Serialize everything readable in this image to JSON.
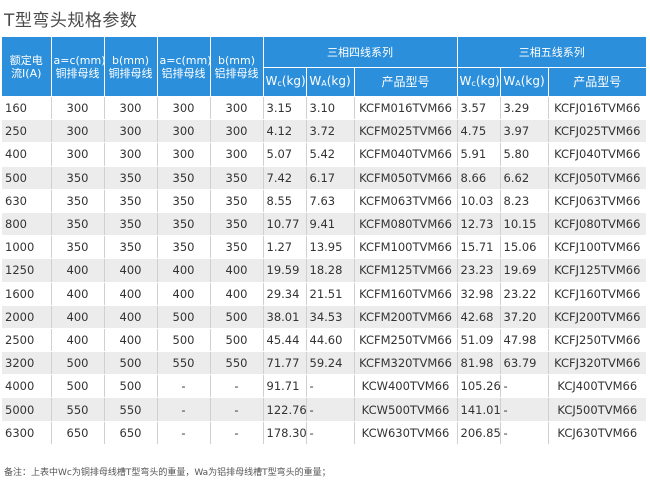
{
  "title": "T型弯头规格参数",
  "headers": {
    "current_line1": "额定电",
    "current_line2": "流I(A)",
    "cu_ac_line1": "a=c(mm)",
    "cu_ac_line2": "铜排母线",
    "cu_b_line1": "b(mm)",
    "cu_b_line2": "铜排母线",
    "al_ac_line1": "a=c(mm)",
    "al_ac_line2": "铝排母线",
    "al_b_line1": "b(mm)",
    "al_b_line2": "铝排母线",
    "group4": "三相四线系列",
    "group5": "三相五线系列",
    "wc_pre": "W",
    "wc_sub": "c",
    "wc_post": "(kg)",
    "wa_pre": "W",
    "wa_sub": "A",
    "wa_post": "(kg)",
    "model": "产品型号"
  },
  "rows": [
    [
      "160",
      "300",
      "300",
      "300",
      "300",
      "3.15",
      "3.10",
      "KCFM016TVM66",
      "3.57",
      "3.29",
      "KCFJ016TVM66"
    ],
    [
      "250",
      "300",
      "300",
      "300",
      "300",
      "4.12",
      "3.72",
      "KCFM025TVM66",
      "4.75",
      "3.97",
      "KCFJ025TVM66"
    ],
    [
      "400",
      "300",
      "300",
      "300",
      "300",
      "5.07",
      "5.42",
      "KCFM040TVM66",
      "5.91",
      "5.80",
      "KCFJ040TVM66"
    ],
    [
      "500",
      "350",
      "350",
      "350",
      "350",
      "7.42",
      "6.17",
      "KCFM050TVM66",
      "8.66",
      "6.62",
      "KCFJ050TVM66"
    ],
    [
      "630",
      "350",
      "350",
      "350",
      "350",
      "8.55",
      "7.63",
      "KCFM063TVM66",
      "10.03",
      "8.23",
      "KCFJ063TVM66"
    ],
    [
      "800",
      "350",
      "350",
      "350",
      "350",
      "10.77",
      "9.41",
      "KCFM080TVM66",
      "12.73",
      "10.15",
      "KCFJ080TVM66"
    ],
    [
      "1000",
      "350",
      "350",
      "350",
      "350",
      "1.27",
      "13.95",
      "KCFM100TVM66",
      "15.71",
      "15.06",
      "KCFJ100TVM66"
    ],
    [
      "1250",
      "400",
      "400",
      "400",
      "400",
      "19.59",
      "18.28",
      "KCFM125TVM66",
      "23.23",
      "19.69",
      "KCFJ125TVM66"
    ],
    [
      "1600",
      "400",
      "400",
      "400",
      "400",
      "29.34",
      "21.51",
      "KCFM160TVM66",
      "32.98",
      "23.22",
      "KCFJ160TVM66"
    ],
    [
      "2000",
      "400",
      "400",
      "500",
      "500",
      "38.01",
      "34.53",
      "KCFM200TVM66",
      "42.68",
      "37.20",
      "KCFJ200TVM66"
    ],
    [
      "2500",
      "400",
      "400",
      "500",
      "500",
      "45.44",
      "44.60",
      "KCFM250TVM66",
      "51.09",
      "47.98",
      "KCFJ250TVM66"
    ],
    [
      "3200",
      "500",
      "500",
      "550",
      "550",
      "71.77",
      "59.24",
      "KCFM320TVM66",
      "81.98",
      "63.79",
      "KCFJ320TVM66"
    ],
    [
      "4000",
      "500",
      "500",
      "-",
      "-",
      "91.71",
      "-",
      "KCW400TVM66",
      "105.26",
      "-",
      "KCJ400TVM66"
    ],
    [
      "5000",
      "550",
      "550",
      "-",
      "-",
      "122.76",
      "-",
      "KCW500TVM66",
      "141.01",
      "-",
      "KCJ500TVM66"
    ],
    [
      "6300",
      "650",
      "650",
      "-",
      "-",
      "178.30",
      "-",
      "KCW630TVM66",
      "206.85",
      "-",
      "KCJ630TVM66"
    ]
  ],
  "note": "备注：上表中Wc为铜排母线槽T型弯头的重量，Wa为铝排母线槽T型弯头的重量；"
}
